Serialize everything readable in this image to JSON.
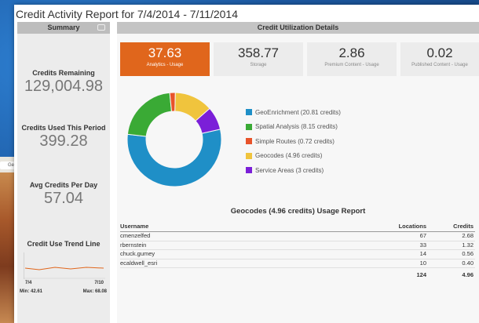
{
  "title": "Credit Activity Report for 7/4/2014 - 7/11/2014",
  "summary": {
    "header": "Summary",
    "metrics": [
      {
        "label": "Credits Remaining",
        "value": "129,004.98"
      },
      {
        "label": "Credits Used This Period",
        "value": "399.28"
      },
      {
        "label": "Avg Credits Per Day",
        "value": "57.04"
      }
    ],
    "trend": {
      "label": "Credit Use Trend Line",
      "start": "7/4",
      "end": "7/10",
      "min": "Min: 42.61",
      "max": "Max: 68.08"
    }
  },
  "utilization": {
    "header": "Credit Utilization Details",
    "tiles": [
      {
        "value": "37.63",
        "label": "Analytics - Usage",
        "active": true
      },
      {
        "value": "358.77",
        "label": "Storage"
      },
      {
        "value": "2.86",
        "label": "Premium Content - Usage"
      },
      {
        "value": "0.02",
        "label": "Published Content - Usage"
      }
    ],
    "legend": [
      {
        "label": "GeoEnrichment (20.81 credits)",
        "color": "#1f8fc7"
      },
      {
        "label": "Spatial Analysis (8.15 credits)",
        "color": "#3aaa35"
      },
      {
        "label": "Simple Routes (0.72 credits)",
        "color": "#e8532a"
      },
      {
        "label": "Geocodes (4.96 credits)",
        "color": "#f0c43d"
      },
      {
        "label": "Service Areas (3 credits)",
        "color": "#7b1fd8"
      }
    ]
  },
  "chart_data": {
    "type": "pie",
    "categories": [
      "GeoEnrichment",
      "Spatial Analysis",
      "Simple Routes",
      "Geocodes",
      "Service Areas"
    ],
    "values": [
      20.81,
      8.15,
      0.72,
      4.96,
      3
    ],
    "colors": [
      "#1f8fc7",
      "#3aaa35",
      "#e8532a",
      "#f0c43d",
      "#7b1fd8"
    ],
    "donut": true
  },
  "usage": {
    "title": "Geocodes (4.96 credits) Usage Report",
    "columns": [
      "Username",
      "Locations",
      "Credits"
    ],
    "rows": [
      [
        "cmenzelfed",
        "67",
        "2.68"
      ],
      [
        "rbernstein",
        "33",
        "1.32"
      ],
      [
        "chuck.gumey",
        "14",
        "0.56"
      ],
      [
        "ecaldwell_esri",
        "10",
        "0.40"
      ]
    ],
    "totals": [
      "",
      "124",
      "4.96"
    ]
  },
  "map_thumb": {
    "label": "Geo"
  }
}
